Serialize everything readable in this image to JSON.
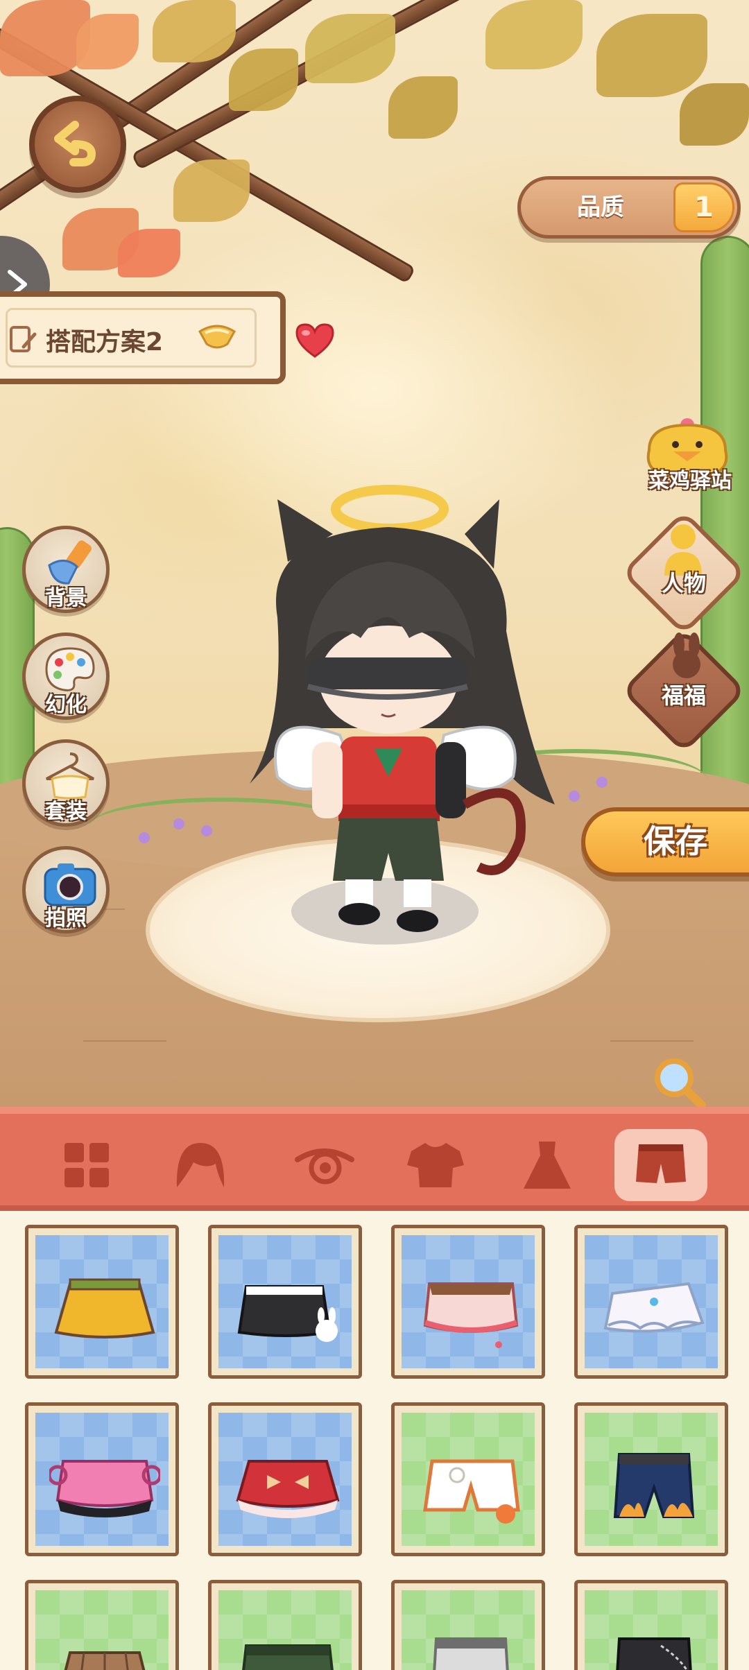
{
  "header": {
    "quality_label": "品质",
    "quality_value": "1"
  },
  "scheme": {
    "label": "搭配方案2"
  },
  "right_menu": {
    "courier_label": "菜鸡驿站",
    "person_label": "人物",
    "fufu_label": "福福"
  },
  "left_tools": [
    {
      "label": "背景",
      "icon": "brush-icon"
    },
    {
      "label": "幻化",
      "icon": "palette-icon"
    },
    {
      "label": "套装",
      "icon": "suit-hanger-icon"
    },
    {
      "label": "拍照",
      "icon": "camera-icon"
    }
  ],
  "actions": {
    "save_label": "保存"
  },
  "categories": [
    {
      "icon": "grid-all-icon",
      "active": false
    },
    {
      "icon": "hair-icon",
      "active": false
    },
    {
      "icon": "eye-icon",
      "active": false
    },
    {
      "icon": "top-shirt-icon",
      "active": false
    },
    {
      "icon": "dress-icon",
      "active": false
    },
    {
      "icon": "shorts-icon",
      "active": true
    }
  ],
  "items": [
    {
      "icon": "yellow-skirt-icon",
      "rarity": "blue"
    },
    {
      "icon": "black-skirt-bunny-icon",
      "rarity": "blue"
    },
    {
      "icon": "pink-heart-skirt-icon",
      "rarity": "blue"
    },
    {
      "icon": "white-ruffle-skirt-icon",
      "rarity": "blue"
    },
    {
      "icon": "pink-ribbon-skirt-icon",
      "rarity": "blue"
    },
    {
      "icon": "red-bow-skirt-icon",
      "rarity": "blue"
    },
    {
      "icon": "white-flower-shorts-icon",
      "rarity": "green"
    },
    {
      "icon": "flame-denim-shorts-icon",
      "rarity": "green"
    },
    {
      "icon": "plaid-skirt-icon",
      "rarity": "green"
    },
    {
      "icon": "green-cargo-skirt-icon",
      "rarity": "green"
    },
    {
      "icon": "grey-cargo-pants-icon",
      "rarity": "green"
    },
    {
      "icon": "black-chain-pants-icon",
      "rarity": "green"
    }
  ],
  "colors": {
    "accent": "#e2705a",
    "save_button": "#f3a437",
    "frame_brown": "#8a5d3c",
    "card_blue": "#8fb8e8",
    "card_green": "#a8dc8f"
  }
}
